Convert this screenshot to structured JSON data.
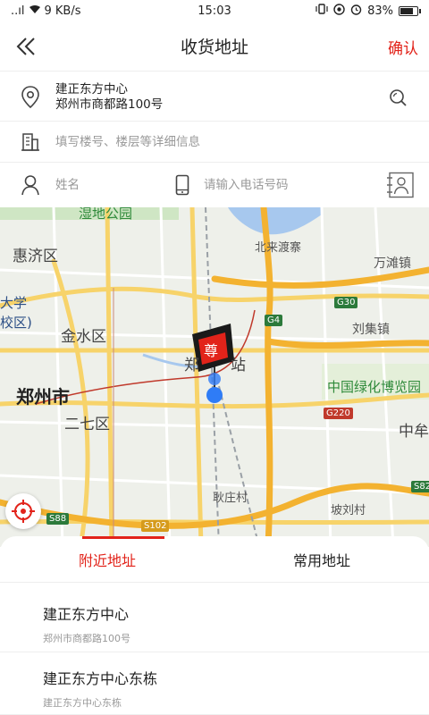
{
  "status": {
    "signal": "..ıl",
    "speed": "9 KB/s",
    "time": "15:03",
    "battery": "83%",
    "battery_level": 0.83
  },
  "header": {
    "title": "收货地址",
    "confirm_label": "确认"
  },
  "address": {
    "name": "建正东方中心",
    "street": "郑州市商都路100号"
  },
  "detail": {
    "placeholder": "填写楼号、楼层等详细信息"
  },
  "contact": {
    "name_placeholder": "姓名",
    "phone_placeholder": "请输入电话号码"
  },
  "map": {
    "labels": [
      "湿地公园",
      "北来渡寨",
      "万滩镇",
      "惠济区",
      "大学",
      "校区)",
      "金水区",
      "刘集镇",
      "郑州市",
      "郑",
      "站",
      "中国绿化博览园",
      "二七区",
      "中牟",
      "耿庄村",
      "坡刘村"
    ],
    "shields": [
      "G30",
      "G4",
      "G220",
      "S82",
      "S88",
      "S102"
    ],
    "marker_char": "尊"
  },
  "tabs": {
    "nearby": "附近地址",
    "common": "常用地址"
  },
  "list": [
    {
      "title": "建正东方中心",
      "sub": "郑州市商都路100号"
    },
    {
      "title": "建正东方中心东栋",
      "sub": "建正东方中心东栋"
    }
  ],
  "colors": {
    "accent": "#e2231a",
    "marker_blue": "#2f7cf6"
  }
}
